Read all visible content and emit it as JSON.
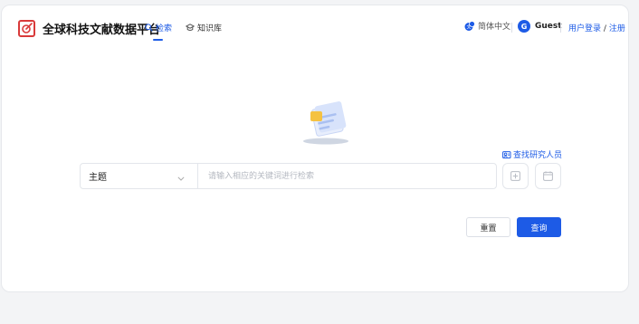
{
  "brand": {
    "title": "全球科技文献数据平台"
  },
  "nav": {
    "tabs": [
      {
        "label": "检索",
        "active": true
      },
      {
        "label": "知识库",
        "active": false
      }
    ]
  },
  "header": {
    "language": "简体中文",
    "user": {
      "initial": "G",
      "name": "Guest"
    },
    "auth": {
      "login": "用户登录",
      "separator": "/",
      "register": "注册"
    }
  },
  "search": {
    "find_researcher": "查找研究人员",
    "field_select": {
      "value": "主题"
    },
    "input": {
      "value": "",
      "placeholder": "请输入相应的关键词进行检索"
    },
    "reset_label": "重置",
    "query_label": "查询"
  },
  "colors": {
    "accent": "#1d5be6",
    "brand_red": "#d93a3a",
    "border": "#e3e6eb",
    "background": "#f3f4f6"
  }
}
